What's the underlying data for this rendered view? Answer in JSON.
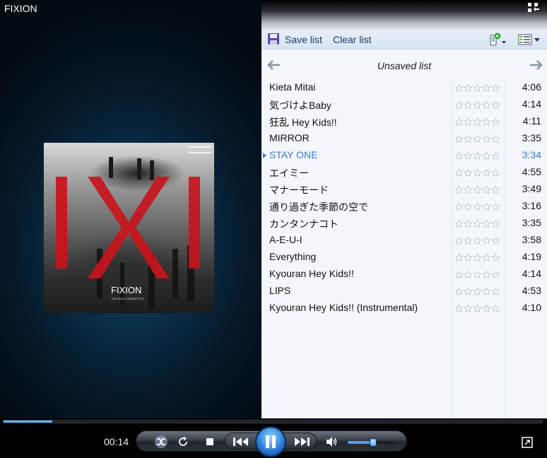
{
  "window": {
    "title": "FIXION"
  },
  "now_playing": {
    "album_art_text": "FIXION",
    "album_art_subtext": "THE ORAL CIGARETTES",
    "album_art_icon": "album-cover-image"
  },
  "toolbar": {
    "save_label": "Save list",
    "clear_label": "Clear list",
    "save_icon": "floppy-disk-icon",
    "device_icon": "sync-device-icon",
    "list_options_icon": "list-options-icon"
  },
  "playlist": {
    "title": "Unsaved list",
    "current_index": 4,
    "tracks": [
      {
        "title": "Kieta Mitai",
        "length": "4:06",
        "rating": 0
      },
      {
        "title": "気づけよBaby",
        "length": "4:14",
        "rating": 0
      },
      {
        "title": "狂乱 Hey Kids!!",
        "length": "4:11",
        "rating": 0
      },
      {
        "title": "MIRROR",
        "length": "3:35",
        "rating": 0
      },
      {
        "title": "STAY ONE",
        "length": "3:34",
        "rating": 0
      },
      {
        "title": "エイミー",
        "length": "4:55",
        "rating": 0
      },
      {
        "title": "マナーモード",
        "length": "3:49",
        "rating": 0
      },
      {
        "title": "通り過ぎた季節の空で",
        "length": "3:16",
        "rating": 0
      },
      {
        "title": "カンタンナコト",
        "length": "3:35",
        "rating": 0
      },
      {
        "title": "A-E-U-I",
        "length": "3:58",
        "rating": 0
      },
      {
        "title": "Everything",
        "length": "4:19",
        "rating": 0
      },
      {
        "title": "Kyouran Hey Kids!!",
        "length": "4:14",
        "rating": 0
      },
      {
        "title": "LIPS",
        "length": "4:53",
        "rating": 0
      },
      {
        "title": "Kyouran Hey Kids!! (Instrumental)",
        "length": "4:10",
        "rating": 0
      }
    ]
  },
  "transport": {
    "elapsed": "00:14",
    "progress_fraction": 0.09,
    "volume_fraction": 0.55,
    "state": "playing"
  },
  "colors": {
    "accent": "#3a7bd5",
    "album_red": "#c8141c"
  }
}
